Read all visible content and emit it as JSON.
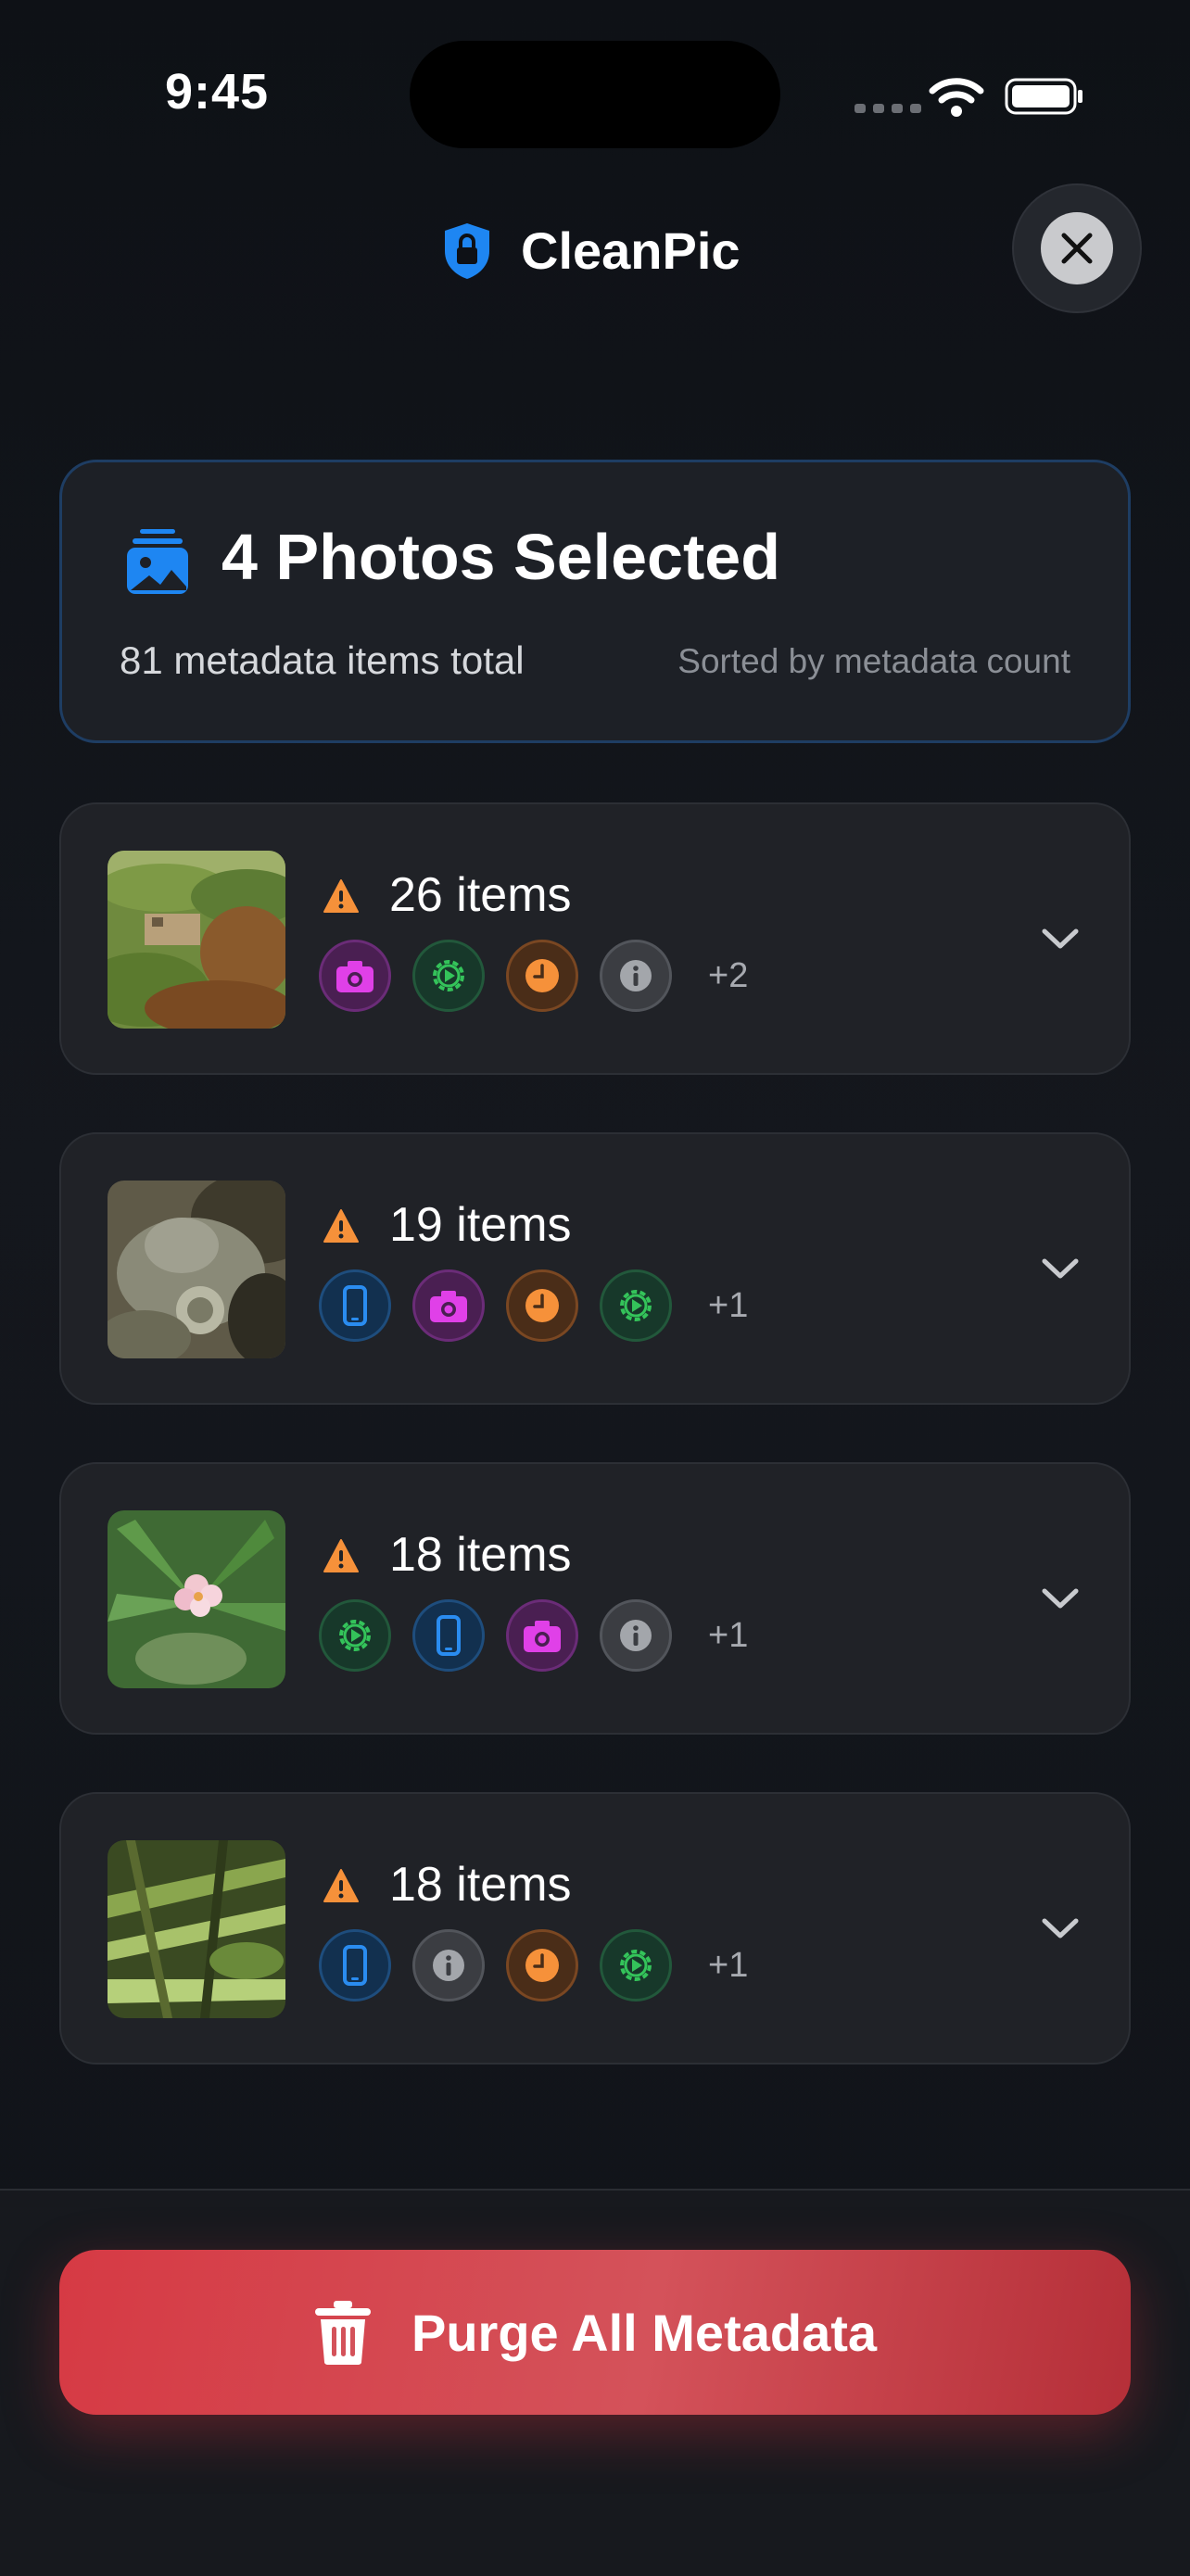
{
  "status_bar": {
    "time": "9:45"
  },
  "header": {
    "title": "CleanPic",
    "close_icon": "close-icon"
  },
  "summary": {
    "title": "4 Photos Selected",
    "total": "81 metadata items total",
    "sort": "Sorted by metadata count"
  },
  "photos": [
    {
      "count": "26 items",
      "badges": [
        "camera",
        "gear",
        "clock",
        "info"
      ],
      "extra": "+2"
    },
    {
      "count": "19 items",
      "badges": [
        "phone",
        "camera",
        "clock",
        "gear"
      ],
      "extra": "+1"
    },
    {
      "count": "18 items",
      "badges": [
        "gear",
        "phone",
        "camera",
        "info"
      ],
      "extra": "+1"
    },
    {
      "count": "18 items",
      "badges": [
        "phone",
        "info",
        "clock",
        "gear"
      ],
      "extra": "+1"
    }
  ],
  "footer": {
    "purge_label": "Purge All Metadata"
  },
  "colors": {
    "accent": "#1e86f2",
    "warning": "#f6913a",
    "camera": "#e040e8",
    "gear": "#34c35a",
    "clock": "#f6913a",
    "info": "#a3a6ab",
    "phone": "#2a8cf0",
    "danger": "#d63a44"
  }
}
